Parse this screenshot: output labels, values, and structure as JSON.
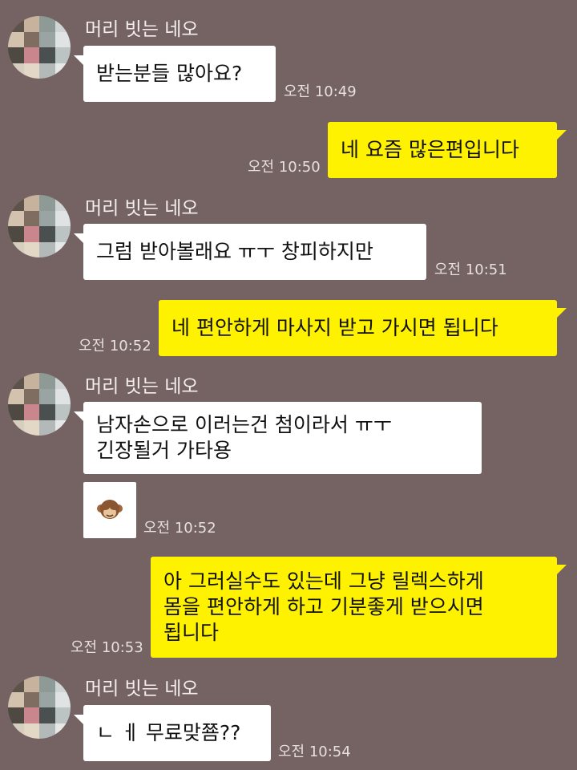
{
  "sender_name": "머리 빗는 네오",
  "messages": [
    {
      "text": "받는분들 많아요?",
      "time": "오전 10:49"
    },
    {
      "text": "네 요즘 많은편입니다",
      "time": "오전 10:50"
    },
    {
      "text": "그럼 받아볼래요 ㅠㅜ 창피하지만",
      "time": "오전 10:51"
    },
    {
      "text": "네 편안하게 마사지 받고 가시면 됩니다",
      "time": "오전 10:52"
    },
    {
      "lines": [
        "남자손으로 이러는건 첨이라서 ㅠㅜ",
        "긴장될거 가타용"
      ]
    },
    {
      "sticker": "see-no-evil-monkey",
      "time": "오전 10:52"
    },
    {
      "lines": [
        "아 그러실수도 있는데 그냥 릴렉스하게",
        "몸을 편안하게 하고 기분좋게 받으시면",
        "됩니다"
      ],
      "time": "오전 10:53"
    },
    {
      "text": "ㄴ ㅔ 무료맞쬼??",
      "time": "오전 10:54"
    }
  ],
  "colors": {
    "background": "#756363",
    "incoming_bubble": "#ffffff",
    "outgoing_bubble": "#fff200"
  }
}
